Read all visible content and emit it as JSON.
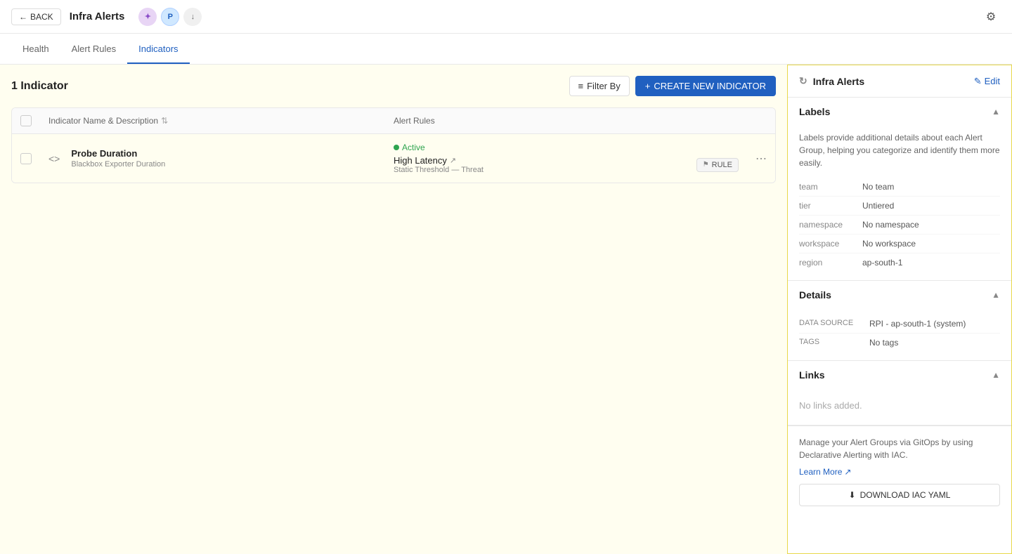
{
  "topbar": {
    "back_label": "BACK",
    "title": "Infra Alerts",
    "avatars": [
      {
        "type": "color",
        "label": "multi",
        "symbol": "✦"
      },
      {
        "type": "letter",
        "label": "P"
      },
      {
        "type": "icon",
        "label": "user"
      }
    ]
  },
  "nav": {
    "tabs": [
      {
        "id": "health",
        "label": "Health",
        "active": false
      },
      {
        "id": "alert-rules",
        "label": "Alert Rules",
        "active": false
      },
      {
        "id": "indicators",
        "label": "Indicators",
        "active": true
      }
    ]
  },
  "toolbar": {
    "indicator_count": "1 Indicator",
    "filter_label": "Filter By",
    "create_label": "CREATE NEW INDICATOR"
  },
  "table": {
    "headers": [
      {
        "id": "checkbox",
        "label": ""
      },
      {
        "id": "name",
        "label": "Indicator Name & Description"
      },
      {
        "id": "rules",
        "label": "Alert Rules"
      },
      {
        "id": "actions",
        "label": ""
      }
    ],
    "rows": [
      {
        "name": "Probe Duration",
        "description": "Blackbox Exporter Duration",
        "status": "Active",
        "rule_name": "High Latency",
        "rule_sub": "Static Threshold — Threat",
        "rule_badge": "RULE"
      }
    ]
  },
  "right_panel": {
    "title": "Infra Alerts",
    "edit_label": "Edit",
    "labels": {
      "section_title": "Labels",
      "description": "Labels provide additional details about each Alert Group, helping you categorize and identify them more easily.",
      "items": [
        {
          "key": "team",
          "value": "No team"
        },
        {
          "key": "tier",
          "value": "Untiered"
        },
        {
          "key": "namespace",
          "value": "No namespace"
        },
        {
          "key": "workspace",
          "value": "No workspace"
        },
        {
          "key": "region",
          "value": "ap-south-1"
        }
      ]
    },
    "details": {
      "section_title": "Details",
      "items": [
        {
          "key": "DATA SOURCE",
          "value": "RPI - ap-south-1 (system)"
        },
        {
          "key": "TAGS",
          "value": "No tags"
        }
      ]
    },
    "links": {
      "section_title": "Links",
      "empty_text": "No links added."
    },
    "iac": {
      "text": "Manage your Alert Groups via GitOps by using Declarative Alerting with IAC.",
      "link_text": "Learn More",
      "download_label": "DOWNLOAD IAC YAML"
    }
  }
}
